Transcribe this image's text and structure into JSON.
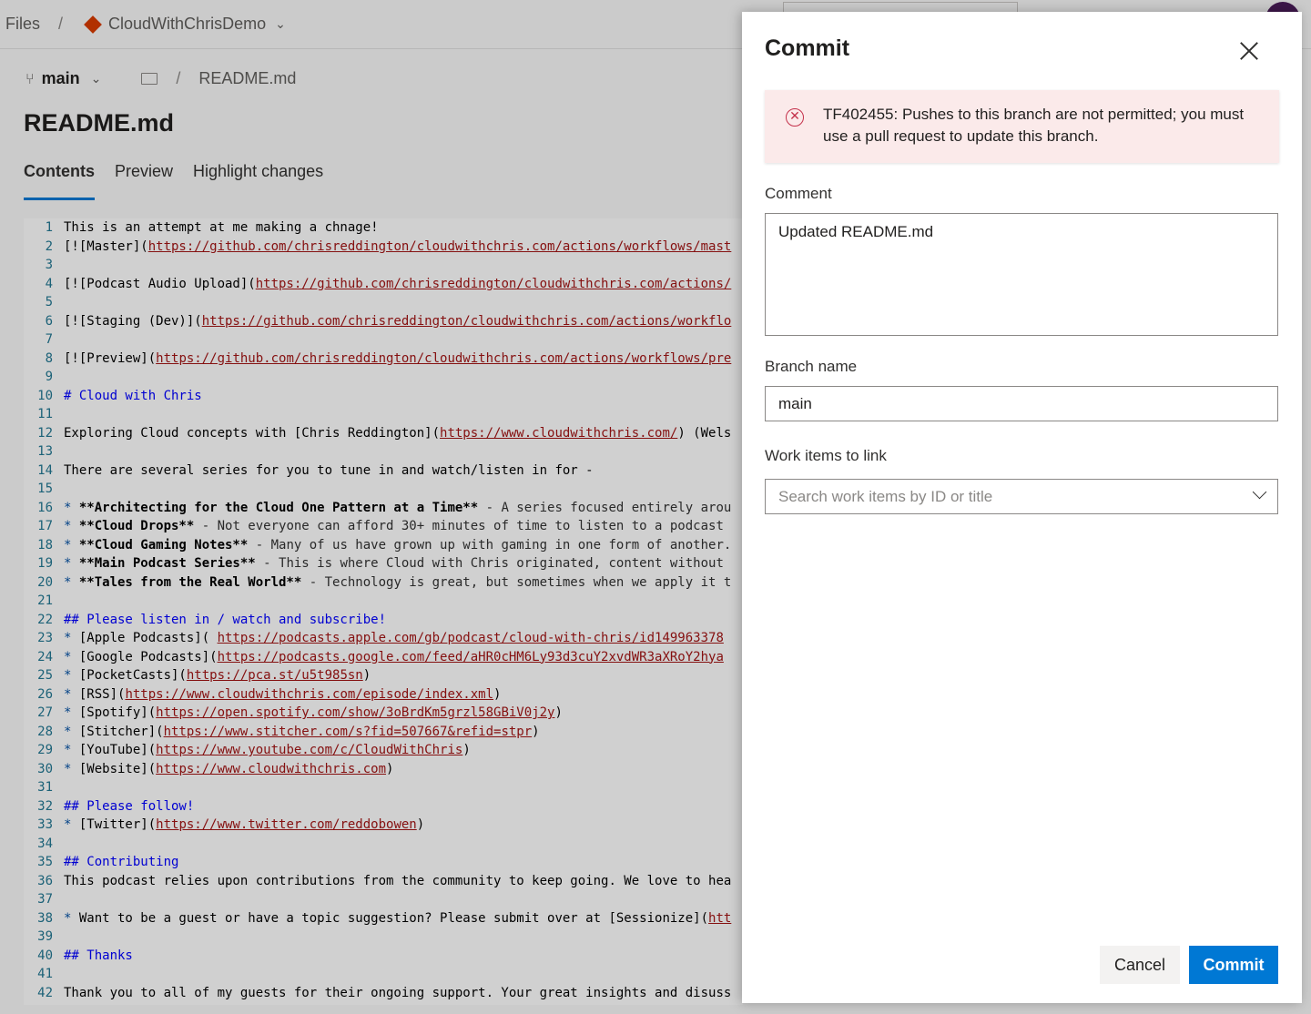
{
  "topbar": {
    "files_label": "Files",
    "separator": "/",
    "repo_name": "CloudWithChrisDemo",
    "chevron": "⌄"
  },
  "pathbar": {
    "branch_icon": "⑂",
    "branch": "main",
    "chevron": "⌄",
    "separator": "/",
    "file_path": "README.md"
  },
  "file_title": "README.md",
  "tabs": [
    {
      "label": "Contents",
      "active": true
    },
    {
      "label": "Preview",
      "active": false
    },
    {
      "label": "Highlight changes",
      "active": false
    }
  ],
  "editor_lines": [
    {
      "n": "1",
      "parts": [
        {
          "t": "This is an attempt at me making a chnage!",
          "c": "code"
        }
      ]
    },
    {
      "n": "2",
      "parts": [
        {
          "t": "[![Master](",
          "c": "code"
        },
        {
          "t": "https://github.com/chrisreddington/cloudwithchris.com/actions/workflows/mast",
          "c": "c-link"
        }
      ]
    },
    {
      "n": "3",
      "parts": []
    },
    {
      "n": "4",
      "parts": [
        {
          "t": "[![Podcast Audio Upload](",
          "c": "code"
        },
        {
          "t": "https://github.com/chrisreddington/cloudwithchris.com/actions/",
          "c": "c-link"
        }
      ]
    },
    {
      "n": "5",
      "parts": []
    },
    {
      "n": "6",
      "parts": [
        {
          "t": "[![Staging (Dev)](",
          "c": "code"
        },
        {
          "t": "https://github.com/chrisreddington/cloudwithchris.com/actions/workflo",
          "c": "c-link"
        }
      ]
    },
    {
      "n": "7",
      "parts": []
    },
    {
      "n": "8",
      "parts": [
        {
          "t": "[![Preview](",
          "c": "code"
        },
        {
          "t": "https://github.com/chrisreddington/cloudwithchris.com/actions/workflows/pre",
          "c": "c-link"
        }
      ]
    },
    {
      "n": "9",
      "parts": []
    },
    {
      "n": "10",
      "parts": [
        {
          "t": "# Cloud with Chris",
          "c": "c-head"
        }
      ]
    },
    {
      "n": "11",
      "parts": []
    },
    {
      "n": "12",
      "parts": [
        {
          "t": "Exploring Cloud concepts with [Chris Reddington](",
          "c": "code"
        },
        {
          "t": "https://www.cloudwithchris.com/",
          "c": "c-link"
        },
        {
          "t": ") (Wels",
          "c": "code"
        }
      ]
    },
    {
      "n": "13",
      "parts": []
    },
    {
      "n": "14",
      "parts": [
        {
          "t": "There are several series for you to tune in and watch/listen in for -",
          "c": "code"
        }
      ]
    },
    {
      "n": "15",
      "parts": []
    },
    {
      "n": "16",
      "parts": [
        {
          "t": "* ",
          "c": "c-bullet"
        },
        {
          "t": "**Architecting for the Cloud One Pattern at a Time**",
          "c": "c-bold"
        },
        {
          "t": " - A series focused entirely arou",
          "c": "c-gray"
        }
      ]
    },
    {
      "n": "17",
      "parts": [
        {
          "t": "* ",
          "c": "c-bullet"
        },
        {
          "t": "**Cloud Drops**",
          "c": "c-bold"
        },
        {
          "t": " - Not everyone can afford 30+ minutes of time to listen to a podcast",
          "c": "c-gray"
        }
      ]
    },
    {
      "n": "18",
      "parts": [
        {
          "t": "* ",
          "c": "c-bullet"
        },
        {
          "t": "**Cloud Gaming Notes**",
          "c": "c-bold"
        },
        {
          "t": " - Many of us have grown up with gaming in one form of another.",
          "c": "c-gray"
        }
      ]
    },
    {
      "n": "19",
      "parts": [
        {
          "t": "* ",
          "c": "c-bullet"
        },
        {
          "t": "**Main Podcast Series**",
          "c": "c-bold"
        },
        {
          "t": " - This is where Cloud with Chris originated, content without",
          "c": "c-gray"
        }
      ]
    },
    {
      "n": "20",
      "parts": [
        {
          "t": "* ",
          "c": "c-bullet"
        },
        {
          "t": "**Tales from the Real World**",
          "c": "c-bold"
        },
        {
          "t": " - Technology is great, but sometimes when we apply it t",
          "c": "c-gray"
        }
      ]
    },
    {
      "n": "21",
      "parts": []
    },
    {
      "n": "22",
      "parts": [
        {
          "t": "## Please listen in / watch and subscribe!",
          "c": "c-head"
        }
      ]
    },
    {
      "n": "23",
      "parts": [
        {
          "t": "* ",
          "c": "c-bullet"
        },
        {
          "t": "[Apple Podcasts]( ",
          "c": "code"
        },
        {
          "t": "https://podcasts.apple.com/gb/podcast/cloud-with-chris/id149963378",
          "c": "c-link"
        }
      ]
    },
    {
      "n": "24",
      "parts": [
        {
          "t": "* ",
          "c": "c-bullet"
        },
        {
          "t": "[Google Podcasts](",
          "c": "code"
        },
        {
          "t": "https://podcasts.google.com/feed/aHR0cHM6Ly93d3cuY2xvdWR3aXRoY2hya",
          "c": "c-link"
        }
      ]
    },
    {
      "n": "25",
      "parts": [
        {
          "t": "* ",
          "c": "c-bullet"
        },
        {
          "t": "[PocketCasts](",
          "c": "code"
        },
        {
          "t": "https://pca.st/u5t985sn",
          "c": "c-link"
        },
        {
          "t": ")",
          "c": "code"
        }
      ]
    },
    {
      "n": "26",
      "parts": [
        {
          "t": "* ",
          "c": "c-bullet"
        },
        {
          "t": "[RSS](",
          "c": "code"
        },
        {
          "t": "https://www.cloudwithchris.com/episode/index.xml",
          "c": "c-link"
        },
        {
          "t": ")",
          "c": "code"
        }
      ]
    },
    {
      "n": "27",
      "parts": [
        {
          "t": "* ",
          "c": "c-bullet"
        },
        {
          "t": "[Spotify](",
          "c": "code"
        },
        {
          "t": "https://open.spotify.com/show/3oBrdKm5grzl58GBiV0j2y",
          "c": "c-link"
        },
        {
          "t": ")",
          "c": "code"
        }
      ]
    },
    {
      "n": "28",
      "parts": [
        {
          "t": "* ",
          "c": "c-bullet"
        },
        {
          "t": "[Stitcher](",
          "c": "code"
        },
        {
          "t": "https://www.stitcher.com/s?fid=507667&refid=stpr",
          "c": "c-link"
        },
        {
          "t": ")",
          "c": "code"
        }
      ]
    },
    {
      "n": "29",
      "parts": [
        {
          "t": "* ",
          "c": "c-bullet"
        },
        {
          "t": "[YouTube](",
          "c": "code"
        },
        {
          "t": "https://www.youtube.com/c/CloudWithChris",
          "c": "c-link"
        },
        {
          "t": ")",
          "c": "code"
        }
      ]
    },
    {
      "n": "30",
      "parts": [
        {
          "t": "* ",
          "c": "c-bullet"
        },
        {
          "t": "[Website](",
          "c": "code"
        },
        {
          "t": "https://www.cloudwithchris.com",
          "c": "c-link"
        },
        {
          "t": ")",
          "c": "code"
        }
      ]
    },
    {
      "n": "31",
      "parts": []
    },
    {
      "n": "32",
      "parts": [
        {
          "t": "## Please follow!",
          "c": "c-head"
        }
      ]
    },
    {
      "n": "33",
      "parts": [
        {
          "t": "* ",
          "c": "c-bullet"
        },
        {
          "t": "[Twitter](",
          "c": "code"
        },
        {
          "t": "https://www.twitter.com/reddobowen",
          "c": "c-link"
        },
        {
          "t": ")",
          "c": "code"
        }
      ]
    },
    {
      "n": "34",
      "parts": []
    },
    {
      "n": "35",
      "parts": [
        {
          "t": "## Contributing",
          "c": "c-head"
        }
      ]
    },
    {
      "n": "36",
      "parts": [
        {
          "t": "This podcast relies upon contributions from the community to keep going. We love to hea",
          "c": "code"
        }
      ]
    },
    {
      "n": "37",
      "parts": []
    },
    {
      "n": "38",
      "parts": [
        {
          "t": "* ",
          "c": "c-bullet"
        },
        {
          "t": "Want to be a guest or have a topic suggestion? Please submit over at [Sessionize](",
          "c": "code"
        },
        {
          "t": "htt",
          "c": "c-link"
        }
      ]
    },
    {
      "n": "39",
      "parts": []
    },
    {
      "n": "40",
      "parts": [
        {
          "t": "## Thanks",
          "c": "c-head"
        }
      ]
    },
    {
      "n": "41",
      "parts": []
    },
    {
      "n": "42",
      "parts": [
        {
          "t": "Thank you to all of my guests for their ongoing support. Your great insights and disuss",
          "c": "code"
        }
      ]
    }
  ],
  "panel": {
    "title": "Commit",
    "close_icon": "close-icon",
    "error": {
      "icon": "error-circle-icon",
      "icon_glyph": "✕",
      "message": "TF402455: Pushes to this branch are not permitted; you must use a pull request to update this branch."
    },
    "comment_label": "Comment",
    "comment_value": "Updated README.md",
    "branch_label": "Branch name",
    "branch_value": "main",
    "work_items_label": "Work items to link",
    "work_items_placeholder": "Search work items by ID or title",
    "cancel_label": "Cancel",
    "commit_label": "Commit"
  },
  "colors": {
    "accent": "#0078d4",
    "error_bg": "#fbeaea",
    "error_icon": "#c4314b"
  }
}
